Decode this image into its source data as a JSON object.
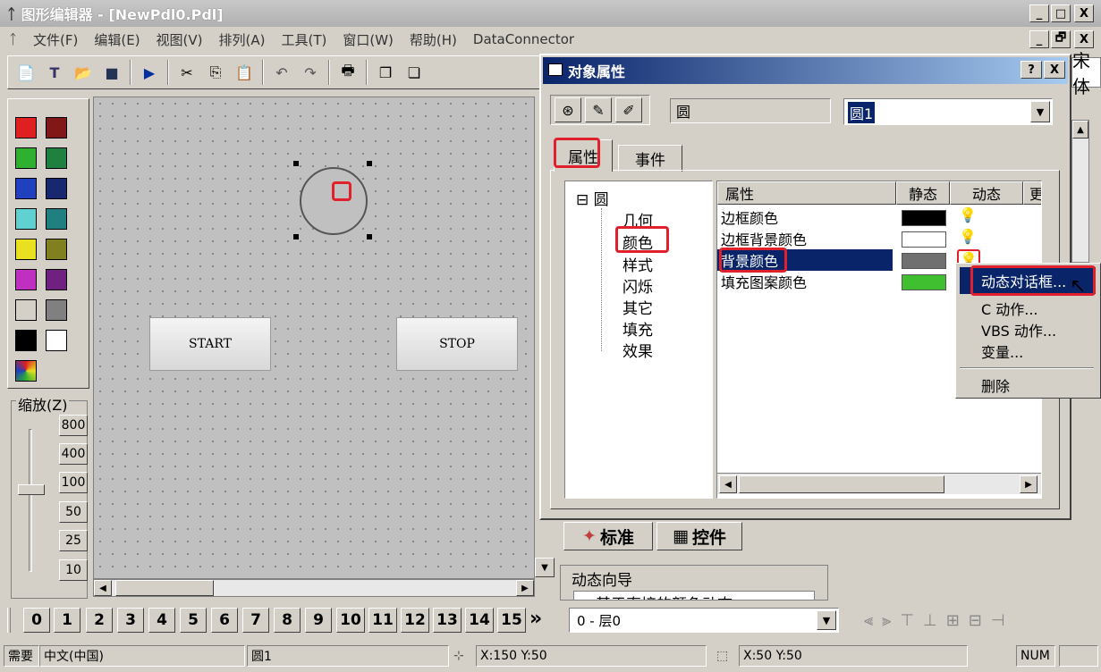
{
  "window": {
    "title": "图形编辑器 - [NewPdl0.Pdl]",
    "minimize": "_",
    "restore": "□",
    "close": "X",
    "restore2": "🗗"
  },
  "menu": [
    "文件(F)",
    "编辑(E)",
    "视图(V)",
    "排列(A)",
    "工具(T)",
    "窗口(W)",
    "帮助(H)",
    "DataConnector"
  ],
  "canvas": {
    "start_label": "START",
    "stop_label": "STOP"
  },
  "zoom": {
    "label": "缩放(Z)",
    "levels": [
      "800",
      "400",
      "100",
      "50",
      "25",
      "10"
    ]
  },
  "dialog": {
    "title": "对象属性",
    "help": "?",
    "close": "X",
    "object_type": "圆",
    "object_name": "圆1",
    "tabs": [
      "属性",
      "事件"
    ],
    "tree_root": "圆",
    "tree_items": [
      "几何",
      "颜色",
      "样式",
      "闪烁",
      "其它",
      "填充",
      "效果"
    ],
    "columns": [
      "属性",
      "静态",
      "动态",
      "更"
    ],
    "rows": [
      {
        "name": "边框颜色",
        "color": "#000000"
      },
      {
        "name": "边框背景颜色",
        "color": "#ffffff"
      },
      {
        "name": "背景颜色",
        "color": "#707070"
      },
      {
        "name": "填充图案颜色",
        "color": "#40c030"
      }
    ]
  },
  "context_menu": [
    "动态对话框...",
    "C 动作...",
    "VBS 动作...",
    "变量...",
    "删除"
  ],
  "right_panel": {
    "font_text": "宋体",
    "tab_standard": "标准",
    "tab_controls": "控件",
    "wizard_title": "动态向导",
    "wizard_item": "基于直接的颜色动态"
  },
  "layers": {
    "numbers": [
      "0",
      "1",
      "2",
      "3",
      "4",
      "5",
      "6",
      "7",
      "8",
      "9",
      "10",
      "11",
      "12",
      "13",
      "14",
      "15"
    ],
    "more": "»",
    "layer_select": "0 - 层0"
  },
  "status": {
    "help": "需要",
    "language": "中文(中国)",
    "object": "圆1",
    "position": "X:150 Y:50",
    "size": "X:50 Y:50",
    "num": "NUM"
  }
}
